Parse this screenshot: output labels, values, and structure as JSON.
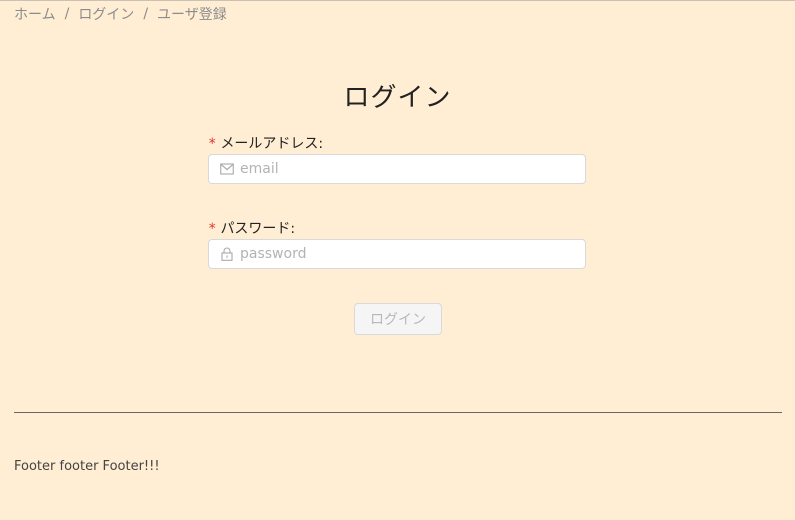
{
  "breadcrumb": {
    "items": [
      "ホーム",
      "ログイン",
      "ユーザ登録"
    ],
    "separator": "/"
  },
  "page": {
    "title": "ログイン"
  },
  "form": {
    "email": {
      "required_mark": "*",
      "label": "メールアドレス:",
      "placeholder": "email",
      "value": "",
      "icon": "mail-icon"
    },
    "password": {
      "required_mark": "*",
      "label": "パスワード:",
      "placeholder": "password",
      "value": "",
      "icon": "lock-icon"
    },
    "submit_label": "ログイン",
    "submit_disabled": true
  },
  "footer": {
    "text": "Footer footer Footer!!!"
  },
  "colors": {
    "background": "#ffeed3",
    "required": "#e03030",
    "input_border": "#d9d9d9",
    "button_disabled_bg": "#f5f5f5",
    "button_disabled_text": "#b8b8b8"
  }
}
